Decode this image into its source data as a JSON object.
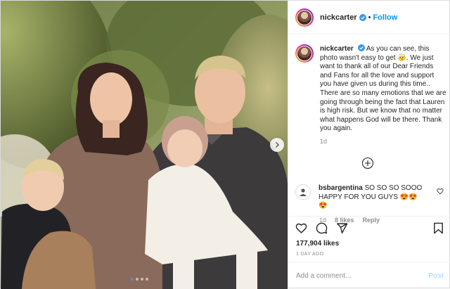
{
  "post": {
    "username": "nickcarter",
    "follow_label": "Follow",
    "separator": "•",
    "caption": {
      "username": "nickcarter",
      "text": "As you can see, this photo wasn't easy to get 🤕. We just want to thank all of our Dear Friends and Fans for all the love and support you have given us during this time.. There are so many emotions that we are going through being the fact that Lauren is high risk. But we know that no matter what happens God will be there. Thank you again.",
      "time": "1d"
    },
    "comment": {
      "username": "bsbargentina",
      "text": "SO SO SO SOOO HAPPY FOR YOU GUYS 😍😍😍",
      "time": "1d",
      "likes": "8 likes",
      "reply_label": "Reply"
    },
    "likes_count": "177,904",
    "likes_label": "likes",
    "posted": "1 DAY AGO",
    "comment_placeholder": "Add a comment...",
    "post_label": "Post",
    "carousel": {
      "count": 4,
      "active": 1
    }
  },
  "icons": {
    "verified": "verified-badge-icon",
    "heart": "heart-icon",
    "comment": "comment-icon",
    "share": "paper-plane-icon",
    "save": "bookmark-icon",
    "more": "plus-circle-icon",
    "next": "chevron-right-icon"
  },
  "colors": {
    "accent": "#0095f6",
    "verified": "#3897f0",
    "muted": "#8e8e8e",
    "border": "#dbdbdb"
  }
}
